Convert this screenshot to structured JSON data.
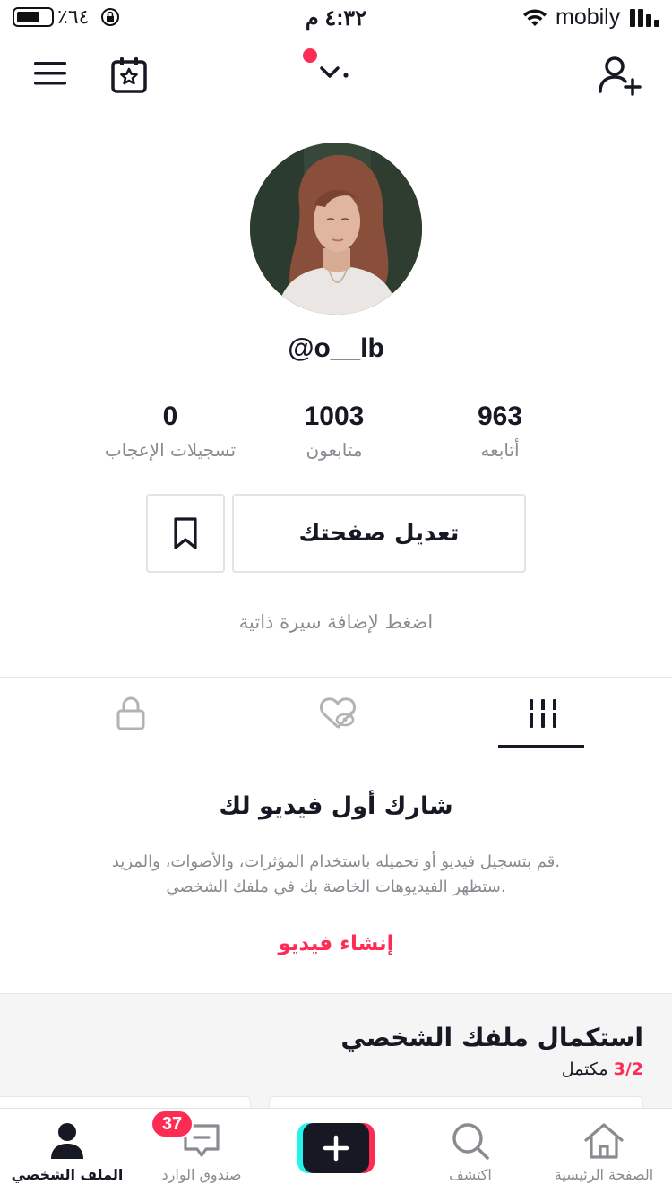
{
  "status_bar": {
    "battery_percent": "٪٦٤",
    "time": "٤:٣٢ م",
    "carrier": "mobily",
    "battery_level": 0.64
  },
  "top_nav": {
    "menu_icon": "hamburger-menu-icon",
    "calendar_icon": "calendar-star-icon",
    "account_switch_icon": "chevron-down-icon",
    "add_user_icon": "add-user-icon"
  },
  "profile": {
    "username": "@o__lb",
    "stats": [
      {
        "value": "963",
        "label": "أتابعه"
      },
      {
        "value": "1003",
        "label": "متابعون"
      },
      {
        "value": "0",
        "label": "تسجيلات الإعجاب"
      }
    ],
    "edit_button": "تعديل صفحتك",
    "bio_placeholder": "اضغط لإضافة سيرة ذاتية"
  },
  "tabs": [
    {
      "name": "videos",
      "icon": "grid-videos-icon",
      "active": true
    },
    {
      "name": "liked",
      "icon": "hidden-heart-icon",
      "active": false
    },
    {
      "name": "private",
      "icon": "lock-icon",
      "active": false
    }
  ],
  "empty_state": {
    "title": "شارك أول فيديو لك",
    "line1": "قم بتسجيل فيديو أو تحميله باستخدام المؤثرات، والأصوات، والمزيد.",
    "line2": "ستظهر الفيديوهات الخاصة بك في ملفك الشخصي.",
    "create_link": "إنشاء فيديو"
  },
  "complete_profile": {
    "title": "استكمال ملفك الشخصي",
    "progress": "3/2",
    "progress_label": "مكتمل"
  },
  "bottom_nav": {
    "home": "الصفحة الرئيسية",
    "discover": "اكتشف",
    "inbox": "صندوق الوارد",
    "inbox_badge": "37",
    "profile": "الملف الشخصي"
  },
  "colors": {
    "accent": "#fe2c55",
    "cyan": "#25f4ee",
    "text": "#161823",
    "muted": "#8a8b91"
  }
}
